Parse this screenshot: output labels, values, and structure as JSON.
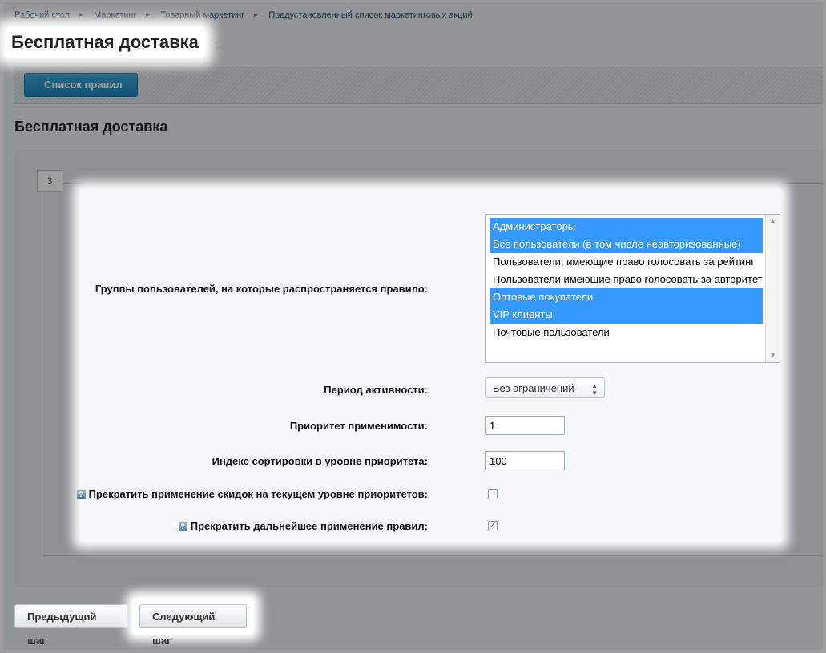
{
  "breadcrumb": [
    "Рабочий стол",
    "Маркетинг",
    "Товарный маркетинг",
    "Предустановленный список маркетинговых акций"
  ],
  "page_title": "Бесплатная доставка",
  "toolbar": {
    "list_button": "Список правил"
  },
  "section_title": "Бесплатная доставка",
  "tab_number": "3",
  "form": {
    "groups_label": "Группы пользователей, на которые распространяется правило:",
    "groups": [
      {
        "label": "Администраторы",
        "selected": true
      },
      {
        "label": "Все пользователи (в том числе неавторизованные)",
        "selected": true
      },
      {
        "label": "Пользователи, имеющие право голосовать за рейтинг",
        "selected": false
      },
      {
        "label": "Пользователи имеющие право голосовать за авторитет",
        "selected": false
      },
      {
        "label": "Оптовые покупатели",
        "selected": true
      },
      {
        "label": "VIP клиенты",
        "selected": true
      },
      {
        "label": "Почтовые пользователи",
        "selected": false
      }
    ],
    "period_label": "Период активности:",
    "period_value": "Без ограничений",
    "priority_label": "Приоритет применимости:",
    "priority_value": "1",
    "sort_label": "Индекс сортировки в уровне приоритета:",
    "sort_value": "100",
    "stop_discounts_label": "Прекратить применение скидок на текущем уровне приоритетов:",
    "stop_discounts_checked": false,
    "stop_rules_label": "Прекратить дальнейшее применение правил:",
    "stop_rules_checked": true,
    "help_icon": "?"
  },
  "footer": {
    "prev_label": "Предыдущий шаг",
    "next_label": "Следующий шаг"
  },
  "colors": {
    "selection": "#3399ff",
    "button_blue": "#1b86bd"
  }
}
